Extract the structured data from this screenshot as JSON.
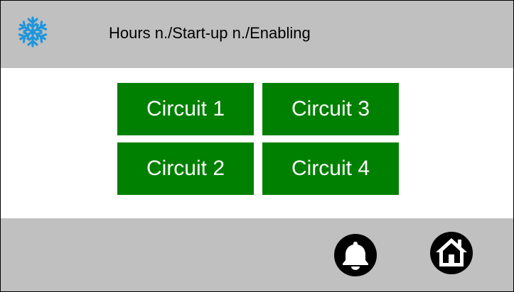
{
  "header": {
    "logo_icon": "snowflake-icon",
    "title": "Hours n./Start-up n./Enabling"
  },
  "circuits": [
    {
      "label": "Circuit 1"
    },
    {
      "label": "Circuit 2"
    },
    {
      "label": "Circuit 3"
    },
    {
      "label": "Circuit 4"
    }
  ],
  "footer": {
    "alarm_icon": "bell-icon",
    "home_icon": "home-icon"
  },
  "colors": {
    "bar_background": "#c0c0c0",
    "button_green": "#008000",
    "button_text": "#ffffff",
    "snowflake_blue": "#1e96dc"
  }
}
